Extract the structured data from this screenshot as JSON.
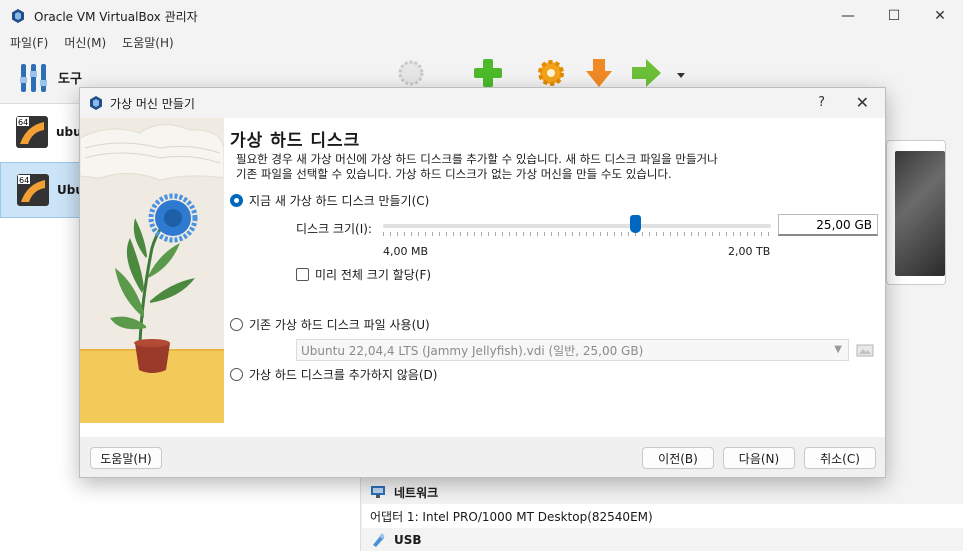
{
  "window": {
    "title": "Oracle VM VirtualBox 관리자",
    "controls": {
      "minimize": "—",
      "maximize": "☐",
      "close": "✕"
    }
  },
  "menu": [
    "파일(F)",
    "머신(M)",
    "도움말(H)"
  ],
  "tools": {
    "label": "도구"
  },
  "vm_list": [
    {
      "name": "ubu",
      "state_icon": "power-icon"
    },
    {
      "name": "Ubu",
      "state_icon": "saved-state-icon",
      "selected": true
    }
  ],
  "details": {
    "network": {
      "title": "네트워크",
      "adapter": "어댑터 1:   Intel PRO/1000 MT Desktop(82540EM)"
    },
    "usb": {
      "title": "USB"
    }
  },
  "dialog": {
    "title": "가상 머신 만들기",
    "help_glyph": "?",
    "close_glyph": "✕",
    "heading": "가상 하드 디스크",
    "description_line1": "필요한 경우 새 가상 머신에 가상 하드 디스크를 추가할 수 있습니다. 새 하드 디스크 파일을 만들거나",
    "description_line2": "기존 파일을 선택할 수 있습니다. 가상 하드 디스크가 없는 가상 머신을 만들 수도 있습니다.",
    "option_create": "지금 새 가상 하드 디스크 만들기(C)",
    "disk_size_label": "디스크 크기(I):",
    "disk_size_value": "25,00 GB",
    "disk_size_fraction": 0.65,
    "slider_min": "4,00 MB",
    "slider_max": "2,00 TB",
    "preallocate_label": "미리 전체 크기 할당(F)",
    "option_existing": "기존 가상 하드 디스크 파일 사용(U)",
    "existing_file": "Ubuntu 22,04,4 LTS (Jammy Jellyfish).vdi (일반, 25,00 GB)",
    "option_none": "가상 하드 디스크를 추가하지 않음(D)",
    "buttons": {
      "help": "도움말(H)",
      "back": "이전(B)",
      "next": "다음(N)",
      "cancel": "취소(C)"
    }
  }
}
